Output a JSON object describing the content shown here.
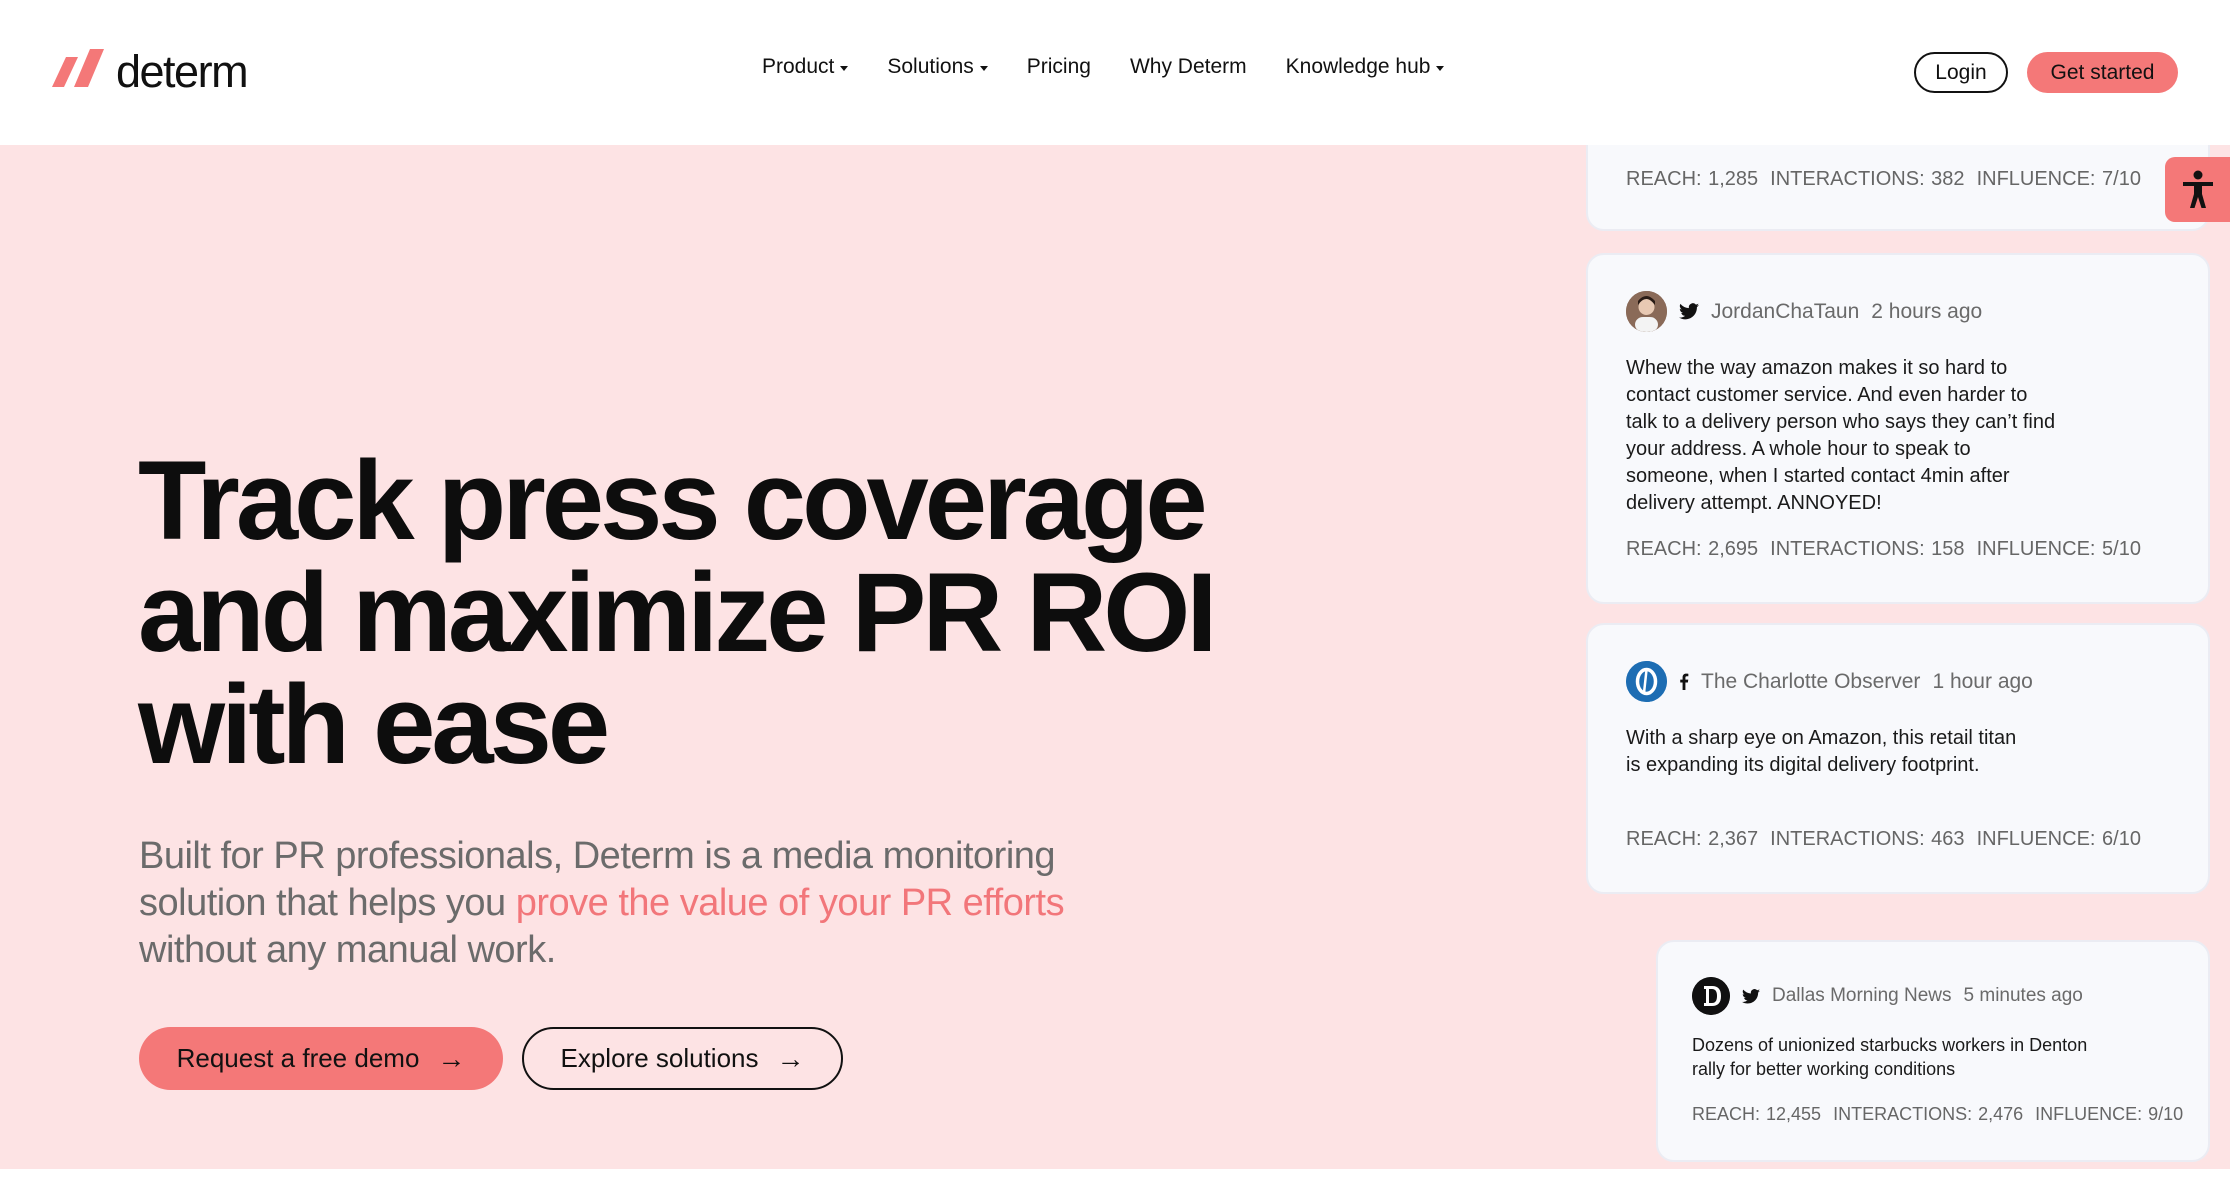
{
  "brand": {
    "name": "determ",
    "color": "#f47878"
  },
  "nav": {
    "items": [
      {
        "label": "Product",
        "dropdown": true
      },
      {
        "label": "Solutions",
        "dropdown": true
      },
      {
        "label": "Pricing",
        "dropdown": false
      },
      {
        "label": "Why Determ",
        "dropdown": false
      },
      {
        "label": "Knowledge hub",
        "dropdown": true
      }
    ],
    "login": "Login",
    "get_started": "Get started"
  },
  "hero": {
    "headline_line1": "Track press coverage",
    "headline_line2": "and maximize PR ROI",
    "headline_line3": "with ease",
    "sub_part1": "Built for PR professionals, Determ is a media monitoring solution that helps you ",
    "sub_accent": "prove the value of your PR efforts",
    "sub_part2": " without any manual work.",
    "cta_primary": "Request a free demo",
    "cta_secondary": "Explore solutions",
    "arrow": "→"
  },
  "mentions": [
    {
      "author": "",
      "source_icon": "",
      "time": "",
      "text": "",
      "reach": "REACH: 1,285",
      "interactions": "INTERACTIONS: 382",
      "influence": "INFLUENCE: 7/10"
    },
    {
      "author": "JordanChaTaun",
      "source_icon": "twitter-icon",
      "time": "2 hours ago",
      "text": "Whew the way amazon makes it so hard to contact customer service. And even harder to talk to a delivery person who says they can’t find your address. A whole hour to speak to someone, when I started contact 4min after delivery attempt. ANNOYED!",
      "reach": "REACH: 2,695",
      "interactions": "INTERACTIONS: 158",
      "influence": "INFLUENCE: 5/10"
    },
    {
      "author": "The Charlotte Observer",
      "source_icon": "facebook-icon",
      "time": "1 hour ago",
      "text": "With a sharp eye on Amazon, this retail titan is expanding its digital delivery footprint.",
      "reach": "REACH: 2,367",
      "interactions": "INTERACTIONS: 463",
      "influence": "INFLUENCE: 6/10"
    },
    {
      "author": "Dallas Morning News",
      "source_icon": "twitter-icon",
      "time": "5 minutes ago",
      "text": "Dozens of unionized starbucks workers in Denton rally for better working conditions",
      "reach": "REACH: 12,455",
      "interactions": "INTERACTIONS: 2,476",
      "influence": "INFLUENCE: 9/10"
    }
  ],
  "colors": {
    "hero_bg": "#fde3e4",
    "accent": "#f47878",
    "card_bg": "#f8f9fc"
  }
}
